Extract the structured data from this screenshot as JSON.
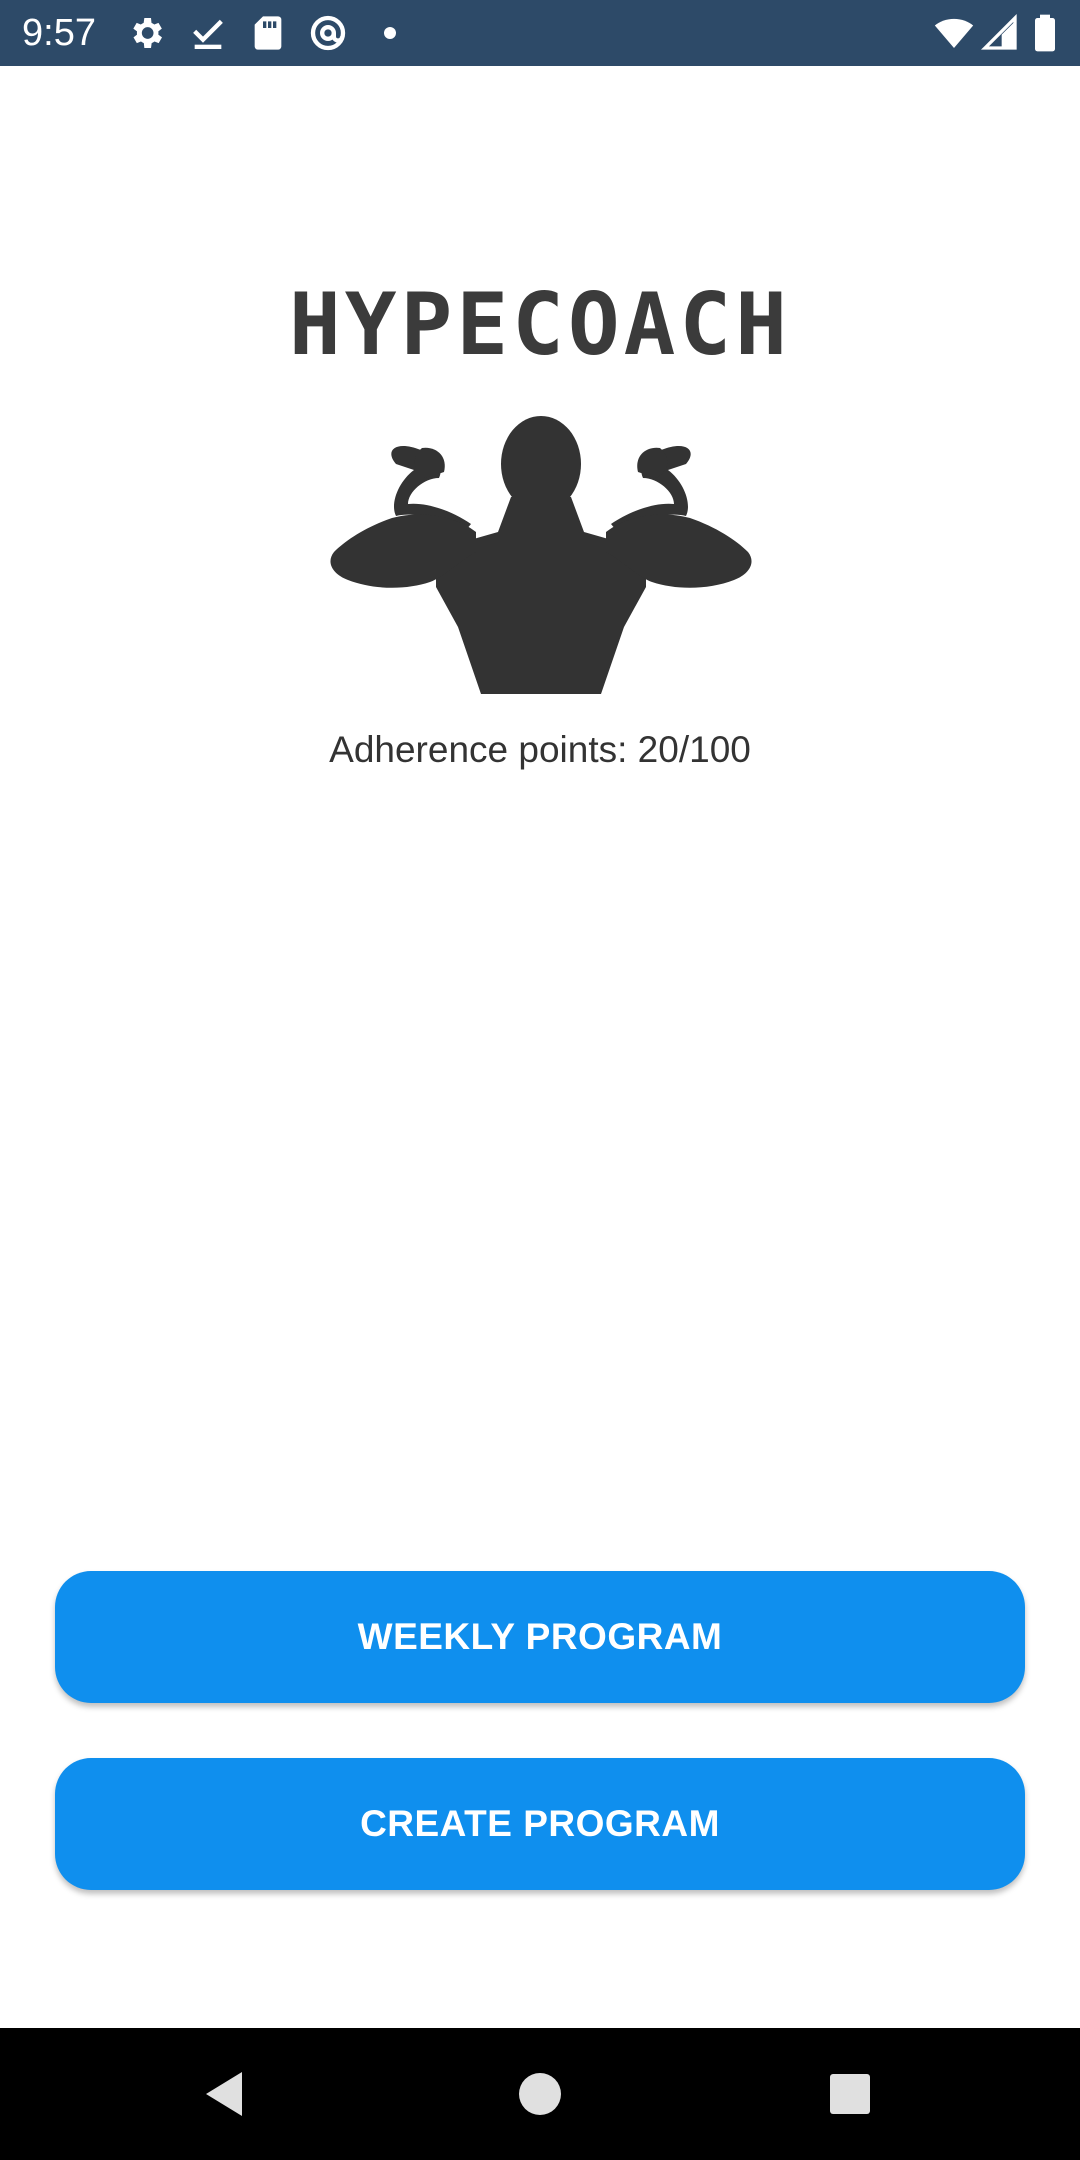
{
  "status_bar": {
    "time": "9:57",
    "left_icons": [
      "gear-icon",
      "checkmark-icon",
      "sd-card-icon",
      "at-sign-icon",
      "dot-icon"
    ],
    "right_icons": [
      "wifi-icon",
      "cell-signal-icon",
      "battery-icon"
    ]
  },
  "app": {
    "title": "HYPECOACH",
    "hero_image": "bodybuilder-flexing-icon",
    "adherence_text": "Adherence points: 20/100"
  },
  "buttons": {
    "weekly_program": "WEEKLY PROGRAM",
    "create_program": "CREATE PROGRAM"
  },
  "nav_bar": {
    "buttons": [
      "back-icon",
      "home-icon",
      "recents-icon"
    ]
  },
  "colors": {
    "status_bar": "#2d4a68",
    "accent": "#0f8fee",
    "title": "#3b3b3b",
    "text": "#333333",
    "nav_bar": "#000000"
  }
}
